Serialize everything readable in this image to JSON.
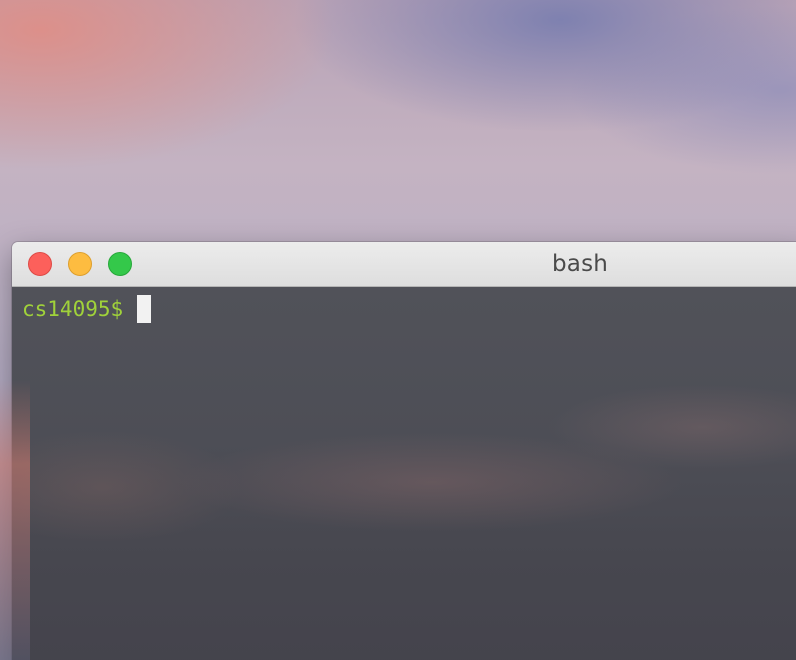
{
  "window": {
    "title": "bash"
  },
  "terminal": {
    "prompt": "cs14095$",
    "input": ""
  },
  "colors": {
    "prompt_text": "#a0d23a",
    "terminal_background": "#4d4e56",
    "close_button": "#fc605b",
    "minimize_button": "#fdbc40",
    "maximize_button": "#34c84a",
    "cursor": "#f2f2f2"
  }
}
